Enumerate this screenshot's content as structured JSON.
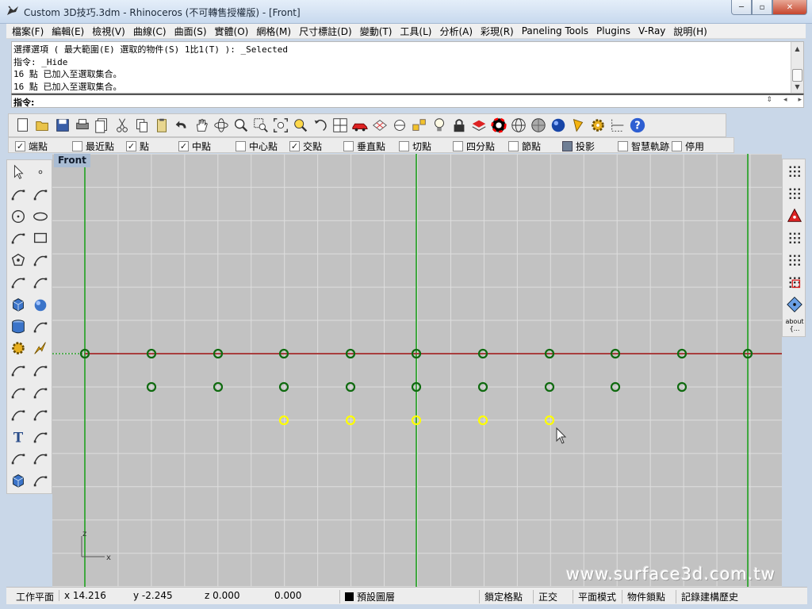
{
  "window": {
    "title": "Custom 3D技巧.3dm - Rhinoceros (不可轉售授權版) - [Front]",
    "min_label": "─",
    "max_label": "▫",
    "close_label": "✕"
  },
  "menu": [
    "檔案(F)",
    "編輯(E)",
    "檢視(V)",
    "曲線(C)",
    "曲面(S)",
    "實體(O)",
    "網格(M)",
    "尺寸標註(D)",
    "變動(T)",
    "工具(L)",
    "分析(A)",
    "彩現(R)",
    "Paneling Tools",
    "Plugins",
    "V-Ray",
    "說明(H)"
  ],
  "command_history": [
    "選擇選項 ( 最大範圍(E)  選取的物件(S)  1比1(T) ): _Selected",
    "指令: _Hide",
    "16 點 已加入至選取集合。",
    "16 點 已加入至選取集合。"
  ],
  "command_prompt": "指令:",
  "toolbar_icons": [
    "new-icon",
    "open-icon",
    "save-icon",
    "print-icon",
    "import-icon",
    "cut-icon",
    "copy-icon",
    "paste-icon",
    "undo-icon",
    "pan-hand-icon",
    "rotate-view-icon",
    "zoom-icon",
    "zoom-window-icon",
    "zoom-extents-icon",
    "zoom-selected-icon",
    "undo-view-icon",
    "four-viewports-icon",
    "car-icon",
    "grid-icon",
    "cplane-icon",
    "osnap-icon",
    "light-icon",
    "lock-icon",
    "layer-icon",
    "color-wheel-icon",
    "wireframe-icon",
    "shaded-icon",
    "rendered-icon",
    "paint-icon",
    "settings-gear-icon",
    "dimension-icon",
    "help-icon"
  ],
  "osnaps": [
    {
      "label": "端點",
      "checked": true
    },
    {
      "label": "最近點",
      "checked": false
    },
    {
      "label": "點",
      "checked": true
    },
    {
      "label": "中點",
      "checked": true
    },
    {
      "label": "中心點",
      "checked": false
    },
    {
      "label": "交點",
      "checked": true
    },
    {
      "label": "垂直點",
      "checked": false
    },
    {
      "label": "切點",
      "checked": false
    },
    {
      "label": "四分點",
      "checked": false
    },
    {
      "label": "節點",
      "checked": false
    },
    {
      "label": "投影",
      "checked": true
    },
    {
      "label": "智慧軌跡",
      "checked": false
    },
    {
      "label": "停用",
      "checked": false
    }
  ],
  "viewport": {
    "title": "Front",
    "axis_x_label": "x",
    "axis_y_label": "z",
    "watermark": "www.surface3d.com.tw",
    "colors": {
      "background": "#c2c2c2",
      "grid": "#dedede",
      "x_axis": "#a52a2a",
      "z_axis": "#14a014",
      "point": "#0f6a0f",
      "selected_point": "#ffff00"
    }
  },
  "right_tools_label": "about {...",
  "status": {
    "cplane": "工作平面",
    "x": "x 14.216",
    "y": "y -2.245",
    "z": "z 0.000",
    "extra": "0.000",
    "layer": "預設圖層",
    "grid_snap": "鎖定格點",
    "ortho": "正交",
    "planar": "平面模式",
    "osnap": "物件鎖點",
    "history": "記錄建構歷史"
  }
}
